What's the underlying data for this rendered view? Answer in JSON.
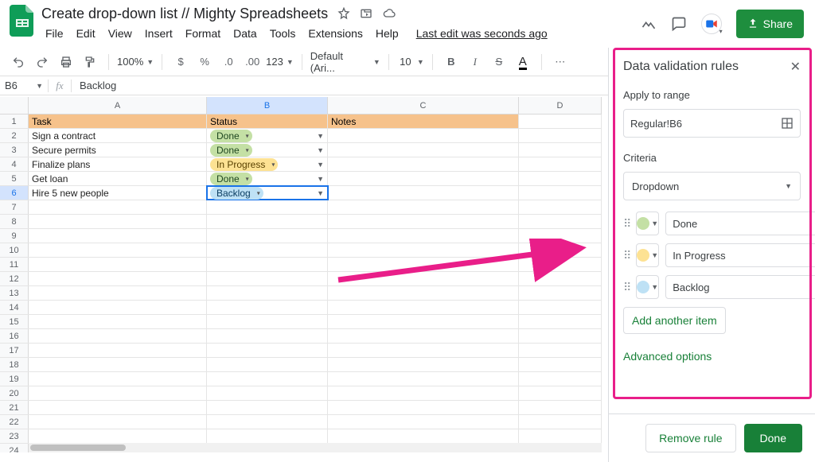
{
  "doc_title": "Create drop-down list // Mighty Spreadsheets",
  "menus": [
    "File",
    "Edit",
    "View",
    "Insert",
    "Format",
    "Data",
    "Tools",
    "Extensions",
    "Help"
  ],
  "last_edit": "Last edit was seconds ago",
  "share_label": "Share",
  "toolbar": {
    "zoom": "100%",
    "decimals_less": ".0",
    "decimals_more": ".00",
    "num_fmt": "123",
    "font_family": "Default (Ari...",
    "font_size": "10"
  },
  "namebox": "B6",
  "formula_value": "Backlog",
  "columns": [
    "A",
    "B",
    "C",
    "D"
  ],
  "headers": {
    "A": "Task",
    "B": "Status",
    "C": "Notes"
  },
  "rows": [
    {
      "task": "Sign a contract",
      "status": "Done",
      "status_cls": "done"
    },
    {
      "task": "Secure permits",
      "status": "Done",
      "status_cls": "done"
    },
    {
      "task": "Finalize plans",
      "status": "In Progress",
      "status_cls": "prog"
    },
    {
      "task": "Get loan",
      "status": "Done",
      "status_cls": "done"
    },
    {
      "task": "Hire 5 new people",
      "status": "Backlog",
      "status_cls": "back"
    }
  ],
  "panel": {
    "title": "Data validation rules",
    "apply_label": "Apply to range",
    "range": "Regular!B6",
    "criteria_label": "Criteria",
    "criteria_value": "Dropdown",
    "options": [
      {
        "color": "g",
        "value": "Done"
      },
      {
        "color": "y",
        "value": "In Progress"
      },
      {
        "color": "b",
        "value": "Backlog"
      }
    ],
    "add_item": "Add another item",
    "advanced": "Advanced options",
    "remove": "Remove rule",
    "done": "Done"
  }
}
